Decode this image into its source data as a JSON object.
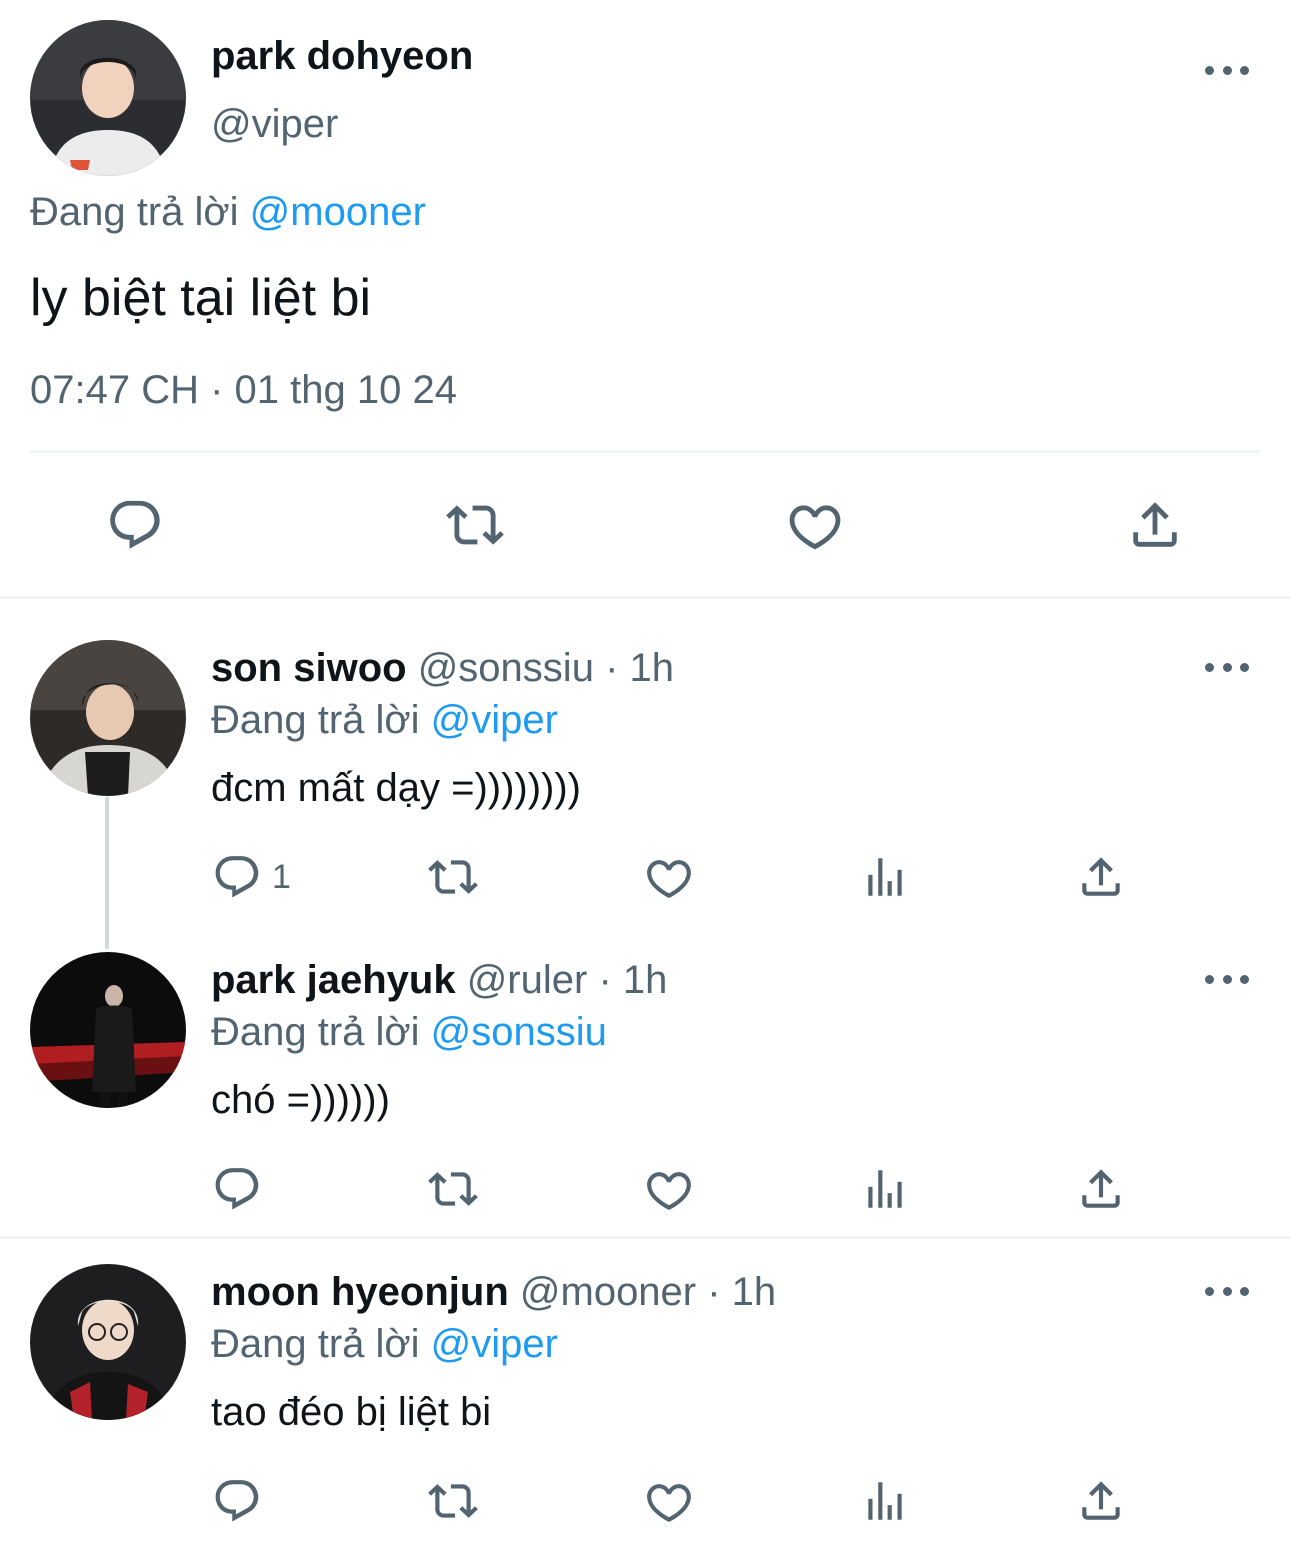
{
  "colors": {
    "text": "#0f1419",
    "muted": "#536471",
    "link": "#1d9bf0",
    "divider": "#eff3f4"
  },
  "main_tweet": {
    "name": "park dohyeon",
    "handle": "@viper",
    "reply_prefix": "Đang trả lời",
    "reply_to": "@mooner",
    "text": "ly biệt tại liệt bi",
    "timestamp": "07:47 CH · 01 thg 10 24",
    "actions": [
      "reply-icon",
      "retweet-icon",
      "like-icon",
      "share-icon"
    ]
  },
  "replies": [
    {
      "name": "son siwoo",
      "handle": "@sonssiu",
      "time": "· 1h",
      "reply_prefix": "Đang trả lời",
      "reply_to": "@viper",
      "text": "đcm mất dạy =))))))))",
      "reply_count": "1",
      "actions": [
        "reply-icon",
        "retweet-icon",
        "like-icon",
        "views-icon",
        "share-icon"
      ]
    },
    {
      "name": "park jaehyuk",
      "handle": "@ruler",
      "time": "· 1h",
      "reply_prefix": "Đang trả lời",
      "reply_to": "@sonssiu",
      "text": "chó =))))))",
      "reply_count": "",
      "actions": [
        "reply-icon",
        "retweet-icon",
        "like-icon",
        "views-icon",
        "share-icon"
      ]
    },
    {
      "name": "moon hyeonjun",
      "handle": "@mooner",
      "time": "· 1h",
      "reply_prefix": "Đang trả lời",
      "reply_to": "@viper",
      "text": "tao đéo bị liệt bi",
      "reply_count": "",
      "actions": [
        "reply-icon",
        "retweet-icon",
        "like-icon",
        "views-icon",
        "share-icon"
      ]
    }
  ]
}
